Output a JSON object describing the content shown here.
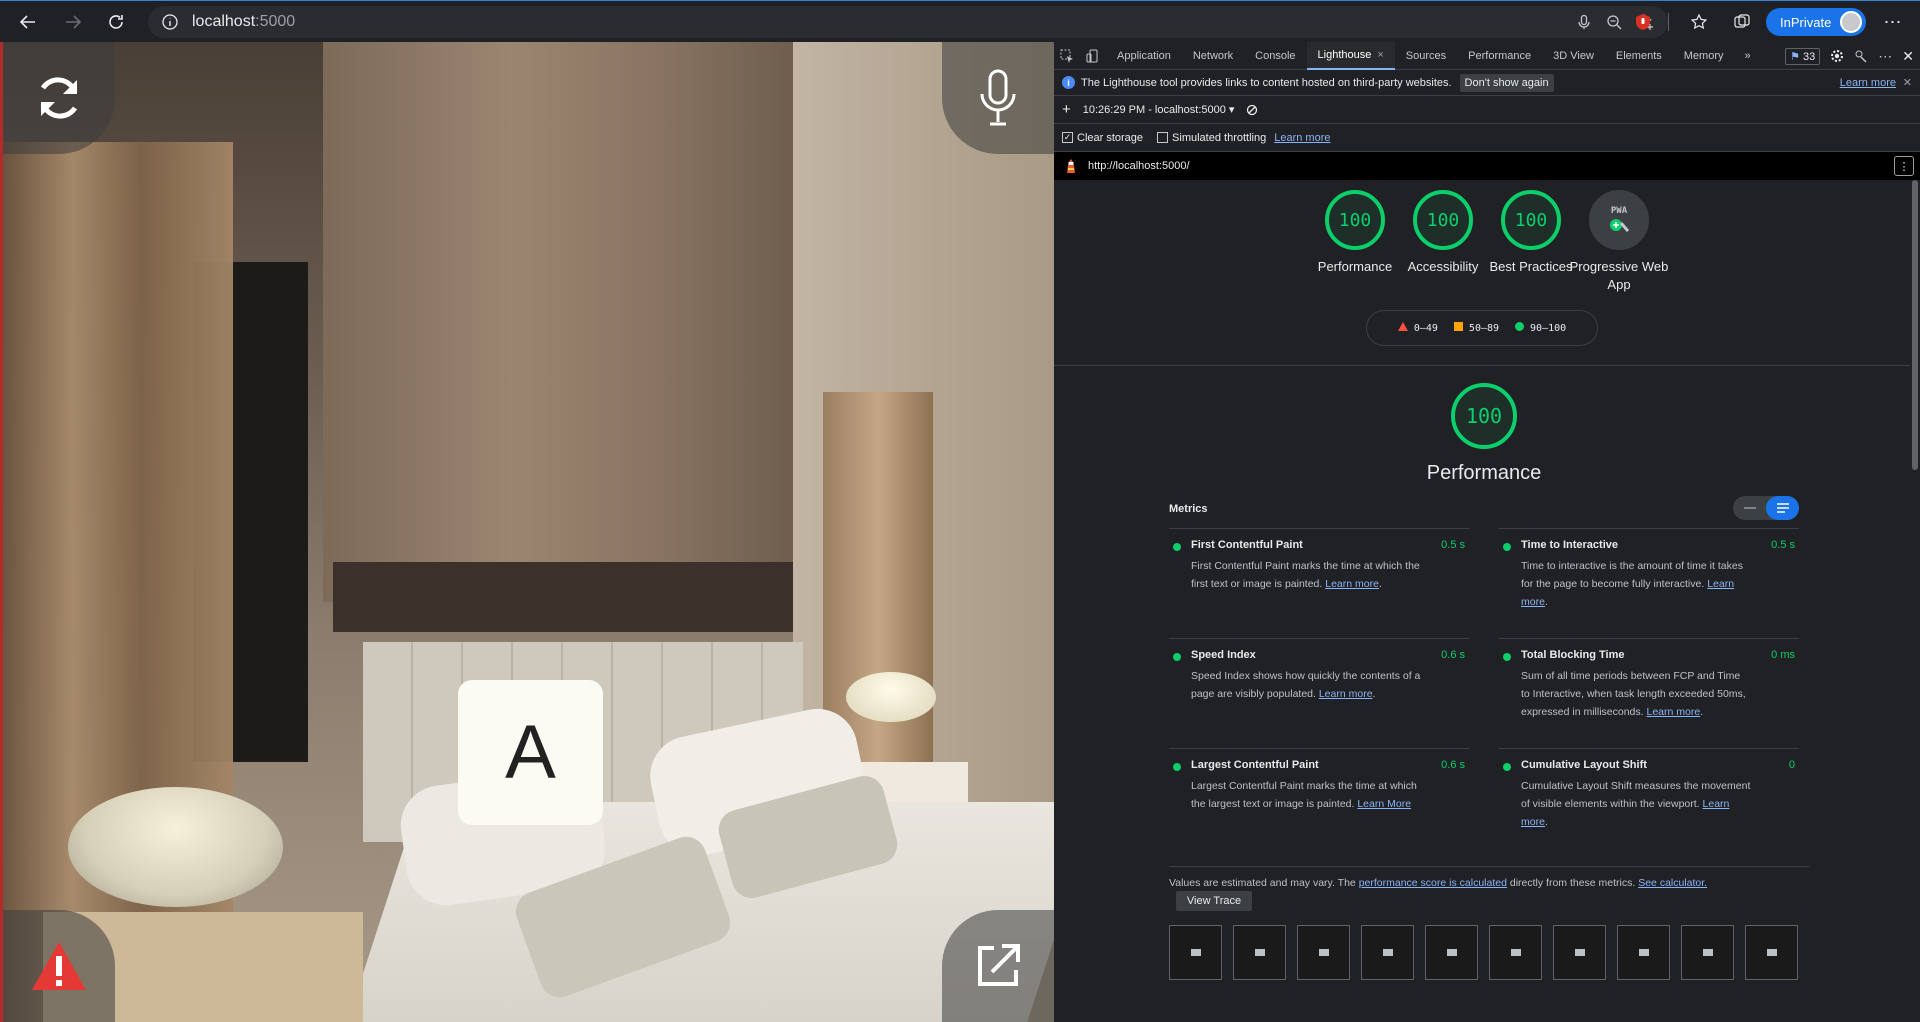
{
  "browser": {
    "url_host": "localhost",
    "url_port": ":5000",
    "inprivate_label": "InPrivate"
  },
  "viewport": {
    "key_label": "A",
    "icons": [
      "refresh-icon",
      "microphone-icon",
      "warning-icon",
      "open-external-icon"
    ]
  },
  "devtools": {
    "tabs": [
      {
        "label": "Application"
      },
      {
        "label": "Network"
      },
      {
        "label": "Console"
      },
      {
        "label": "Lighthouse",
        "active": true
      },
      {
        "label": "Sources"
      },
      {
        "label": "Performance"
      },
      {
        "label": "3D View"
      },
      {
        "label": "Elements"
      },
      {
        "label": "Memory"
      }
    ],
    "issues_count": "33",
    "infobar": {
      "text": "The Lighthouse tool provides links to content hosted on third-party websites.",
      "dont_show": "Don't show again",
      "learn_more": "Learn more"
    },
    "run": {
      "add": "+",
      "report_select": "10:26:29 PM - localhost:5000 ▾"
    },
    "options": {
      "clear_storage": "Clear storage",
      "clear_storage_checked": true,
      "throttling": "Simulated throttling",
      "throttling_checked": false,
      "learn_more": "Learn more"
    },
    "report_url": "http://localhost:5000/"
  },
  "report": {
    "gauges": [
      {
        "score": "100",
        "label": "Performance"
      },
      {
        "score": "100",
        "label": "Accessibility"
      },
      {
        "score": "100",
        "label": "Best Practices"
      },
      {
        "score": "PWA",
        "label": "Progressive Web App"
      }
    ],
    "legend": {
      "low": "0–49",
      "mid": "50–89",
      "high": "90–100"
    },
    "performance_score": "100",
    "performance_title": "Performance",
    "metrics_title": "Metrics",
    "metrics": [
      {
        "name": "First Contentful Paint",
        "value": "0.5 s",
        "desc": "First Contentful Paint marks the time at which the first text or image is painted.",
        "link": "Learn more"
      },
      {
        "name": "Time to Interactive",
        "value": "0.5 s",
        "desc": "Time to interactive is the amount of time it takes for the page to become fully interactive.",
        "link": "Learn more"
      },
      {
        "name": "Speed Index",
        "value": "0.6 s",
        "desc": "Speed Index shows how quickly the contents of a page are visibly populated.",
        "link": "Learn more"
      },
      {
        "name": "Total Blocking Time",
        "value": "0 ms",
        "desc": "Sum of all time periods between FCP and Time to Interactive, when task length exceeded 50ms, expressed in milliseconds.",
        "link": "Learn more"
      },
      {
        "name": "Largest Contentful Paint",
        "value": "0.6 s",
        "desc": "Largest Contentful Paint marks the time at which the largest text or image is painted.",
        "link": "Learn More"
      },
      {
        "name": "Cumulative Layout Shift",
        "value": "0",
        "desc": "Cumulative Layout Shift measures the movement of visible elements within the viewport.",
        "link": "Learn more"
      }
    ],
    "note": {
      "prefix": "Values are estimated and may vary. The ",
      "link1": "performance score is calculated",
      "middle": " directly from these metrics. ",
      "link2": "See calculator."
    },
    "view_trace": "View Trace",
    "accent_green": "#0cce6b"
  }
}
